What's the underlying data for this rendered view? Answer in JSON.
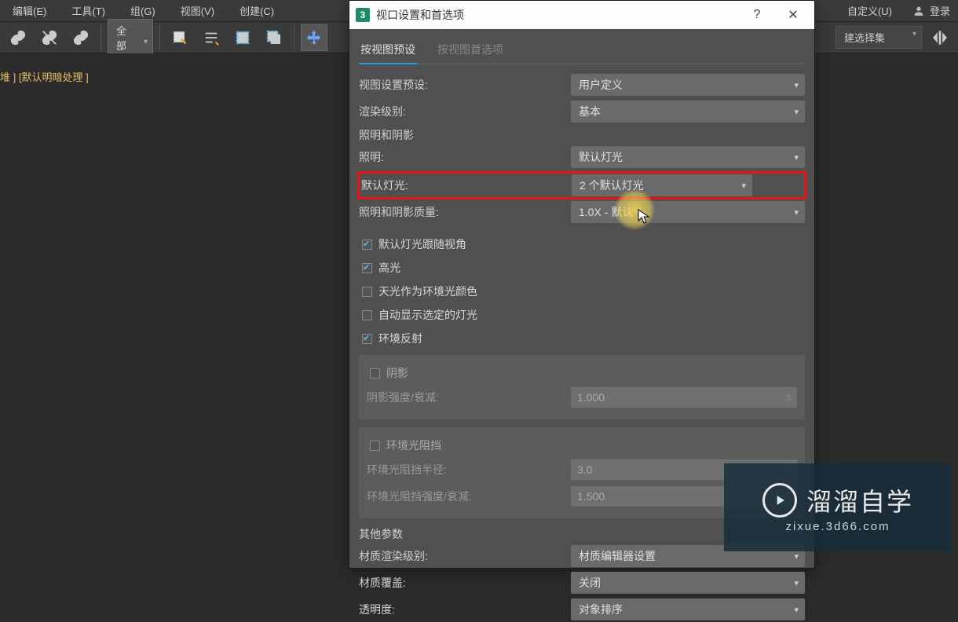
{
  "menubar": {
    "items": [
      "编辑(E)",
      "工具(T)",
      "组(G)",
      "视图(V)",
      "创建(C)",
      "自定义(U)"
    ],
    "login": "登录"
  },
  "toolbar": {
    "filter_combo": "全部",
    "selection_set_label": "建选择集"
  },
  "viewport": {
    "label_bracket": "堆 ]",
    "label_mode": "[默认明暗处理 ]"
  },
  "dialog": {
    "title": "视口设置和首选项",
    "help": "?",
    "close": "✕",
    "tabs": {
      "preset": "按视图预设",
      "prefs": "按视图首选项"
    },
    "rows": {
      "preset_label": "视图设置预设:",
      "preset_value": "用户定义",
      "render_level_label": "渲染级别:",
      "render_level_value": "基本",
      "light_shadow_section": "照明和阴影",
      "lighting_label": "照明:",
      "lighting_value": "默认灯光",
      "default_light_label": "默认灯光:",
      "default_light_value": "2 个默认灯光",
      "quality_label": "照明和阴影质量:",
      "quality_value": "1.0X - 默认"
    },
    "checks": {
      "follow_view": "默认灯光跟随视角",
      "highlights": "高光",
      "skylight_ambient": "天光作为环境光颜色",
      "auto_show_selected_light": "自动显示选定的灯光",
      "env_reflect": "环境反射"
    },
    "shadow_panel": {
      "shadow_cb": "阴影",
      "shadow_falloff_label": "阴影强度/衰减:",
      "shadow_falloff_value": "1.000"
    },
    "ao_panel": {
      "ao_cb": "环境光阻挡",
      "ao_radius_label": "环境光阻挡半径:",
      "ao_radius_value": "3.0",
      "ao_strength_label": "环境光阻挡强度/衰减:",
      "ao_strength_value": "1.500"
    },
    "other_section": "其他参数",
    "other": {
      "mat_render_label": "材质渲染级别:",
      "mat_render_value": "材质编辑器设置",
      "mat_override_label": "材质覆盖:",
      "mat_override_value": "关闭",
      "transparency_label": "透明度:",
      "transparency_value": "对象排序"
    }
  },
  "watermark": {
    "title": "溜溜自学",
    "url": "zixue.3d66.com"
  }
}
